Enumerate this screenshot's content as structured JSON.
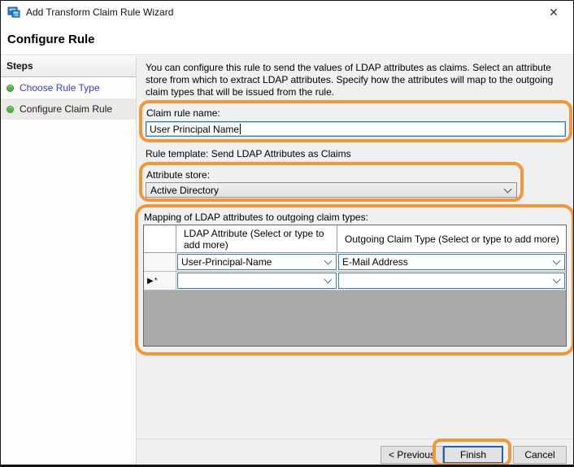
{
  "window": {
    "title": "Add Transform Claim Rule Wizard",
    "heading": "Configure Rule",
    "close_glyph": "✕"
  },
  "sidebar": {
    "header": "Steps",
    "steps": [
      {
        "label": "Choose Rule Type",
        "state": "completed"
      },
      {
        "label": "Configure Claim Rule",
        "state": "current"
      }
    ]
  },
  "content": {
    "description": "You can configure this rule to send the values of LDAP attributes as claims. Select an attribute store from which to extract LDAP attributes. Specify how the attributes will map to the outgoing claim types that will be issued from the rule.",
    "claim_rule_name": {
      "label": "Claim rule name:",
      "value": "User Principal Name"
    },
    "rule_template": "Rule template: Send LDAP Attributes as Claims",
    "attribute_store": {
      "label": "Attribute store:",
      "value": "Active Directory"
    },
    "mapping": {
      "label": "Mapping of LDAP attributes to outgoing claim types:",
      "columns": [
        "LDAP Attribute (Select or type to add more)",
        "Outgoing Claim Type (Select or type to add more)"
      ],
      "rows": [
        {
          "marker": "",
          "ldap_attribute": "User-Principal-Name",
          "outgoing_claim_type": "E-Mail Address"
        },
        {
          "marker": "▶*",
          "ldap_attribute": "",
          "outgoing_claim_type": ""
        }
      ]
    }
  },
  "footer": {
    "previous_label": "< Previous",
    "finish_label": "Finish",
    "cancel_label": "Cancel"
  },
  "colors": {
    "annotation_highlight": "#F0973B",
    "focused_input_border": "#2D7CC1",
    "combo_border": "#3C7AB8",
    "default_button_border": "#1F63B2",
    "step_link_blue": "#3A3AD0",
    "step_dot_green": "#4DB548",
    "grid_empty_fill": "#A9A9A9",
    "dialog_background": "#F0F0F0"
  }
}
